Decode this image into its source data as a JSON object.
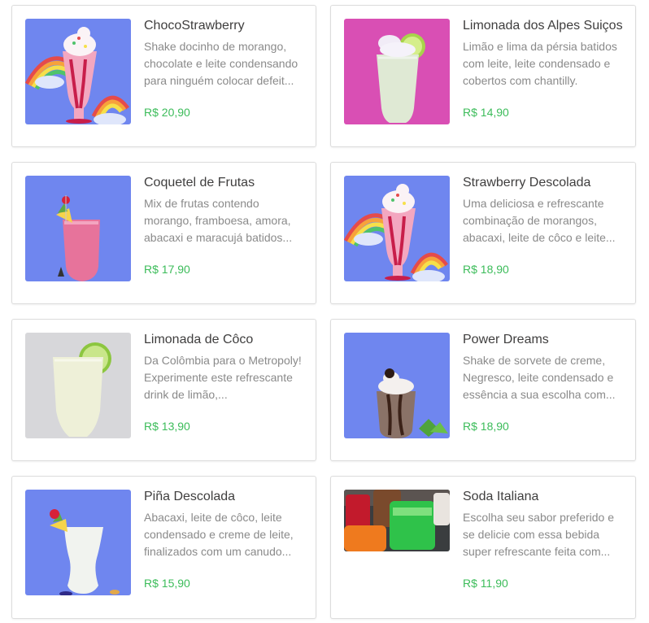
{
  "products": [
    {
      "title": "ChocoStrawberry",
      "description": "Shake docinho de morango, chocolate e leite condensando para ninguém colocar defeit...",
      "price": "R$ 20,90",
      "image": "strawberry-rainbow-shake"
    },
    {
      "title": "Limonada dos Alpes Suiços",
      "description": "Limão e lima da pérsia batidos com leite, leite condensado e cobertos com chantilly.",
      "price": "R$ 14,90",
      "image": "swiss-lemonade"
    },
    {
      "title": "Coquetel de Frutas",
      "description": "Mix de frutas contendo morango, framboesa, amora, abacaxi e maracujá batidos...",
      "price": "R$ 17,90",
      "image": "fruit-cocktail"
    },
    {
      "title": "Strawberry Descolada",
      "description": "Uma deliciosa e refrescante combinação de morangos, abacaxi, leite de côco e leite...",
      "price": "R$ 18,90",
      "image": "strawberry-rainbow-shake"
    },
    {
      "title": "Limonada de Côco",
      "description": "Da Colômbia para o Metropoly! Experimente este refrescante drink de limão,...",
      "price": "R$ 13,90",
      "image": "coconut-lemonade"
    },
    {
      "title": "Power Dreams",
      "description": "Shake de sorvete de creme, Negresco, leite condensado e essência a sua escolha com...",
      "price": "R$ 18,90",
      "image": "chocolate-shake"
    },
    {
      "title": "Piña Descolada",
      "description": "Abacaxi, leite de côco, leite condensado e creme de leite, finalizados com um canudo...",
      "price": "R$ 15,90",
      "image": "pina-colada"
    },
    {
      "title": "Soda Italiana",
      "description": "Escolha seu sabor preferido e se delicie com essa bebida super refrescante feita com...",
      "price": "R$ 11,90",
      "image": "italian-sodas"
    }
  ],
  "colors": {
    "price": "#3cbc5a",
    "title": "#3f3e3e",
    "description": "#8a8a8a",
    "border": "#dcdcdc",
    "blue_bg": "#6f86ef",
    "pink_bg": "#d94fb4",
    "grey_bg": "#d7d7da"
  }
}
